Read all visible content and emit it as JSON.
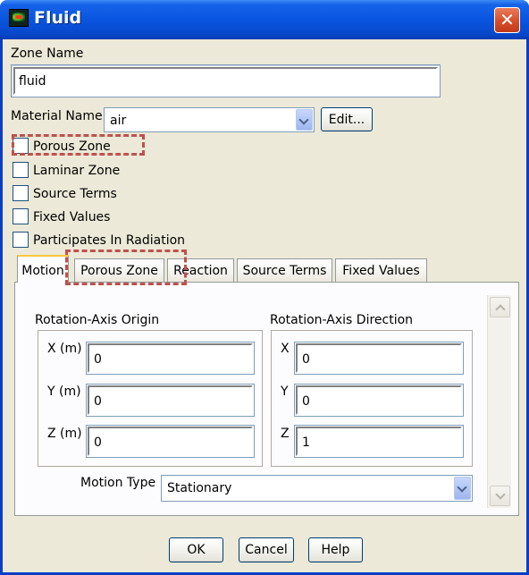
{
  "window": {
    "title": "Fluid",
    "close_glyph": "✕"
  },
  "zone": {
    "label": "Zone Name",
    "value": "fluid"
  },
  "material": {
    "label": "Material Name",
    "value": "air",
    "edit_label": "Edit..."
  },
  "checkboxes": [
    {
      "label": "Porous Zone",
      "checked": false
    },
    {
      "label": "Laminar Zone",
      "checked": false
    },
    {
      "label": "Source Terms",
      "checked": false
    },
    {
      "label": "Fixed Values",
      "checked": false
    },
    {
      "label": "Participates In Radiation",
      "checked": false
    }
  ],
  "tabs": [
    {
      "label": "Motion",
      "active": true
    },
    {
      "label": "Porous Zone",
      "active": false
    },
    {
      "label": "Reaction",
      "active": false
    },
    {
      "label": "Source Terms",
      "active": false
    },
    {
      "label": "Fixed Values",
      "active": false
    }
  ],
  "motion": {
    "origin": {
      "title": "Rotation-Axis Origin",
      "fields": [
        {
          "label": "X (m)",
          "value": "0"
        },
        {
          "label": "Y (m)",
          "value": "0"
        },
        {
          "label": "Z (m)",
          "value": "0"
        }
      ]
    },
    "direction": {
      "title": "Rotation-Axis Direction",
      "fields": [
        {
          "label": "X",
          "value": "0"
        },
        {
          "label": "Y",
          "value": "0"
        },
        {
          "label": "Z",
          "value": "1"
        }
      ]
    },
    "motion_type": {
      "label": "Motion Type",
      "value": "Stationary"
    }
  },
  "buttons": {
    "ok": "OK",
    "cancel": "Cancel",
    "help": "Help"
  },
  "colors": {
    "titlebar": "#0a55e0",
    "highlight_dash": "#c0504d",
    "dialog_bg": "#ece9d8"
  }
}
